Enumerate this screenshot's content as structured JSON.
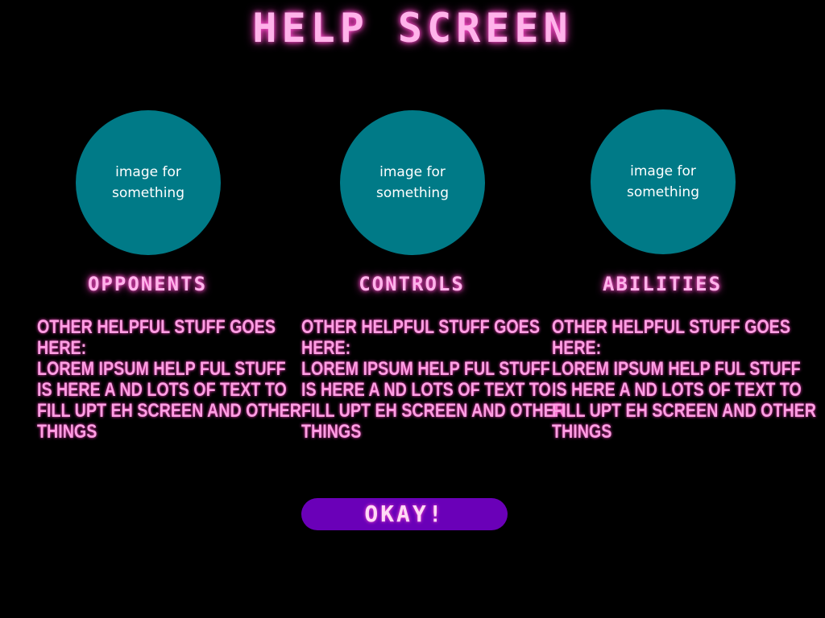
{
  "title": "HELP SCREEN",
  "sections": [
    {
      "image_label": "image for something",
      "heading": "OPPONENTS",
      "body_lines": [
        "OTHER HELPFUL STUFF GOES",
        "HERE:",
        "LOREM IPSUM HELP FUL STUFF",
        "IS HERE A ND LOTS OF TEXT TO",
        "FILL UPT EH SCREEN AND OTHER",
        "THINGS"
      ]
    },
    {
      "image_label": "image for something",
      "heading": "CONTROLS",
      "body_lines": [
        "OTHER HELPFUL STUFF GOES",
        "HERE:",
        "LOREM IPSUM HELP FUL STUFF",
        "IS HERE A ND LOTS OF TEXT TO",
        "FILL UPT EH SCREEN AND OTHER",
        "THINGS"
      ]
    },
    {
      "image_label": "image for something",
      "heading": "ABILITIES",
      "body_lines": [
        "OTHER HELPFUL STUFF GOES",
        "HERE:",
        "LOREM IPSUM HELP FUL STUFF",
        "IS HERE A ND LOTS OF TEXT TO",
        "FILL UPT EH SCREEN AND OTHER",
        "THINGS"
      ]
    }
  ],
  "okay_button": "OKAY!",
  "colors": {
    "background": "#000000",
    "title_pink": "#ffb3ea",
    "circle_teal": "#007a87",
    "button_purple": "#6a00b8"
  }
}
